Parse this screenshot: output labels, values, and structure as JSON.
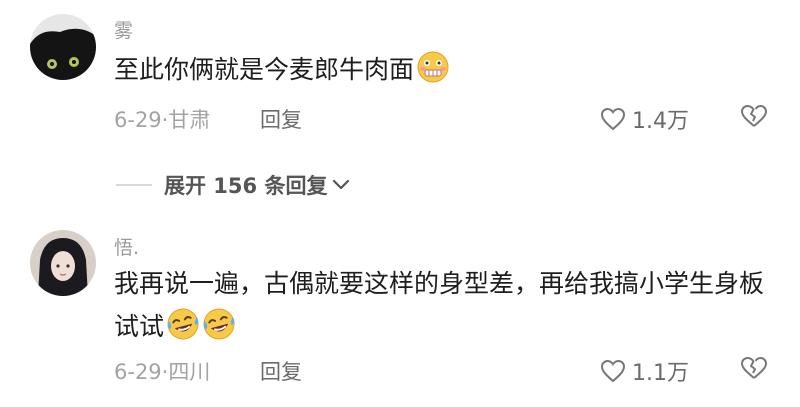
{
  "comments": [
    {
      "username": "雾",
      "text": "至此你俩就是今麦郎牛肉面",
      "emojis": [
        "nervous-grimace-emoji"
      ],
      "date_location": "6-29·甘肃",
      "reply_label": "回复",
      "likes": "1.4万"
    },
    {
      "username": "悟.",
      "text": "我再说一遍，古偶就要这样的身型差，再给我搞小学生身板试试",
      "emojis": [
        "laughing-tears-emoji",
        "laughing-tears-emoji"
      ],
      "date_location": "6-29·四川",
      "reply_label": "回复",
      "likes": "1.1万"
    }
  ],
  "expand_replies": {
    "label": "展开 156 条回复"
  },
  "icons": {
    "like": "heart-outline-icon",
    "dislike": "broken-heart-icon",
    "expand": "chevron-down-icon"
  },
  "colors": {
    "meta_text": "#a3a3a3",
    "body_text": "#1e1e1e",
    "icon": "#6b6b6b"
  }
}
